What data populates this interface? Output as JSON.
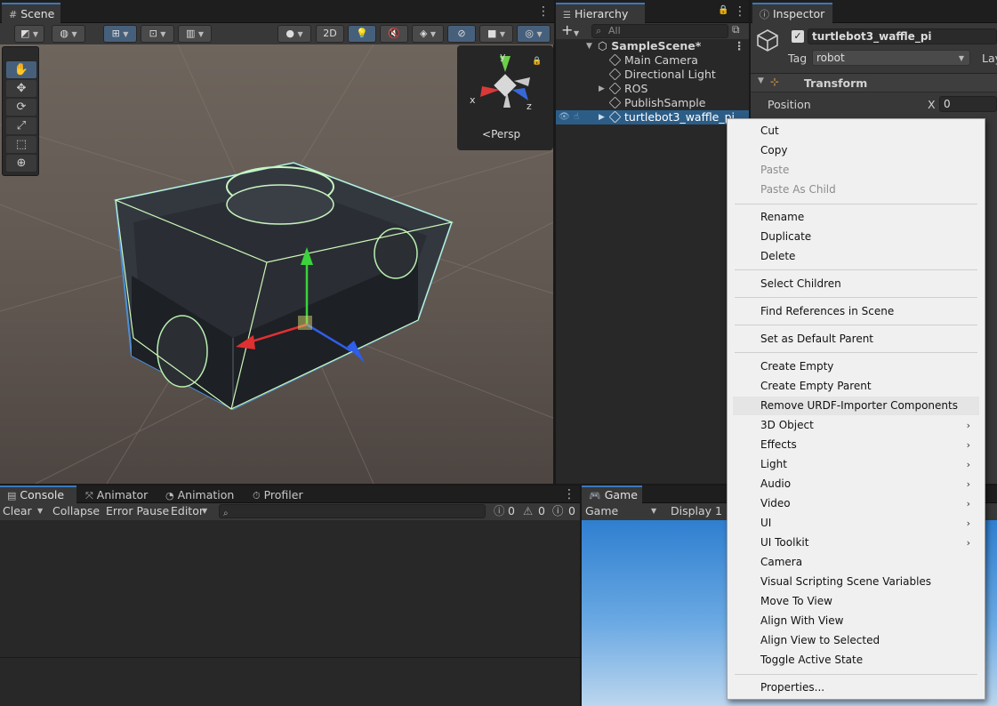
{
  "scene": {
    "tab_label": "Scene",
    "btn_2d": "2D",
    "persp_label": "Persp",
    "axis_x": "x",
    "axis_y": "y",
    "axis_z": "z"
  },
  "hierarchy": {
    "tab_label": "Hierarchy",
    "search_placeholder": "All",
    "items": [
      {
        "label": "SampleScene*"
      },
      {
        "label": "Main Camera"
      },
      {
        "label": "Directional Light"
      },
      {
        "label": "ROS"
      },
      {
        "label": "PublishSample"
      },
      {
        "label": "turtlebot3_waffle_pi"
      }
    ]
  },
  "inspector": {
    "tab_label": "Inspector",
    "object_name": "turtlebot3_waffle_pi",
    "tag_label": "Tag",
    "tag_value": "robot",
    "layer_label": "Lay",
    "component_label": "Transform",
    "position_label": "Position",
    "x_label": "X",
    "x_value": "0"
  },
  "console": {
    "tabs": [
      {
        "label": "Console"
      },
      {
        "label": "Animator"
      },
      {
        "label": "Animation"
      },
      {
        "label": "Profiler"
      }
    ],
    "clear_label": "Clear",
    "collapse_label": "Collapse",
    "error_pause_label": "Error Pause",
    "editor_label": "Editor",
    "info_count": "0",
    "warn_count": "0",
    "error_count": "0"
  },
  "game": {
    "tab_label": "Game",
    "mode_label": "Game",
    "display_label": "Display 1"
  },
  "context_menu": {
    "items": [
      {
        "label": "Cut"
      },
      {
        "label": "Copy"
      },
      {
        "label": "Paste"
      },
      {
        "label": "Paste As Child"
      },
      {
        "label": "Rename"
      },
      {
        "label": "Duplicate"
      },
      {
        "label": "Delete"
      },
      {
        "label": "Select Children"
      },
      {
        "label": "Find References in Scene"
      },
      {
        "label": "Set as Default Parent"
      },
      {
        "label": "Create Empty"
      },
      {
        "label": "Create Empty Parent"
      },
      {
        "label": "Remove URDF-Importer Components"
      },
      {
        "label": "3D Object"
      },
      {
        "label": "Effects"
      },
      {
        "label": "Light"
      },
      {
        "label": "Audio"
      },
      {
        "label": "Video"
      },
      {
        "label": "UI"
      },
      {
        "label": "UI Toolkit"
      },
      {
        "label": "Camera"
      },
      {
        "label": "Visual Scripting Scene Variables"
      },
      {
        "label": "Move To View"
      },
      {
        "label": "Align With View"
      },
      {
        "label": "Align View to Selected"
      },
      {
        "label": "Toggle Active State"
      },
      {
        "label": "Properties..."
      }
    ]
  }
}
